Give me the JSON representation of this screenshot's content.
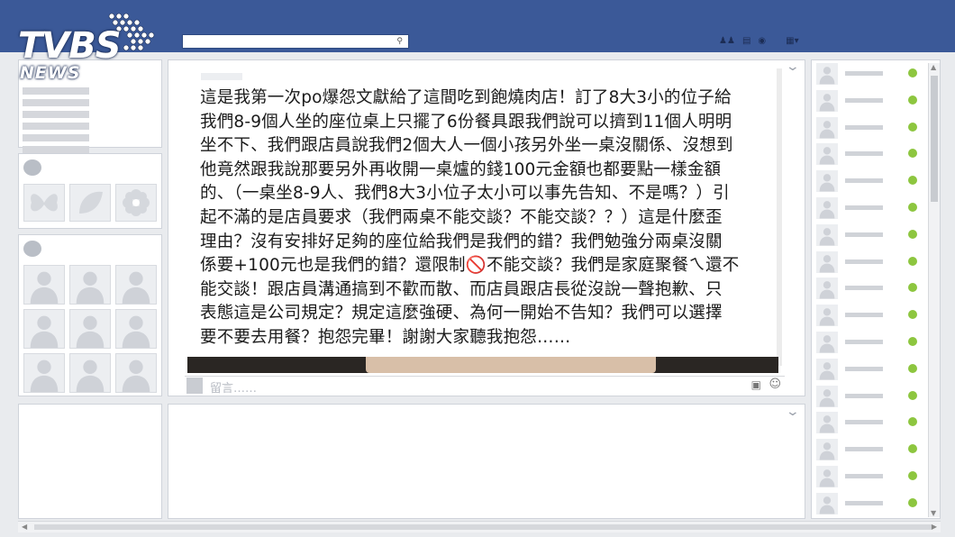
{
  "header": {
    "logo_text": "TVBS",
    "logo_subtext": "NEWS",
    "search_icon": "search-icon"
  },
  "colors": {
    "topbar": "#3b5998",
    "online": "#8dc63f"
  },
  "post": {
    "lines": [
      "這是我第一次po爆怨文獻給了這間吃到飽燒肉店！訂了8大3小的位子給",
      "我們8-9個人坐的座位桌上只擺了6份餐具跟我們說可以擠到11個人明明",
      "坐不下、我們跟店員說我們2個大人一個小孩另外坐一桌沒關係、沒想到",
      "他竟然跟我說那要另外再收開一桌爐的錢100元金額也都要點一樣金額",
      "的、（一桌坐8-9人、我們8大3小位子太小可以事先告知、不是嗎？）引",
      "起不滿的是店員要求（我們兩桌不能交談？不能交談？？）這是什麼歪",
      "理由？沒有安排好足夠的座位給我們是我們的錯？我們勉強分兩桌沒關",
      "係要+100元也是我們的錯？還限制🚫不能交談？我們是家庭聚餐ㄟ還不",
      "能交談！跟店員溝通搞到不歡而散、而店員跟店長從沒說一聲抱歉、只",
      "表態這是公司規定？規定這麼強硬、為何一開始不告知？我們可以選擇",
      "要不要去用餐？抱怨完畢！謝謝大家聽我抱怨……"
    ],
    "comment_placeholder": "留言……"
  }
}
